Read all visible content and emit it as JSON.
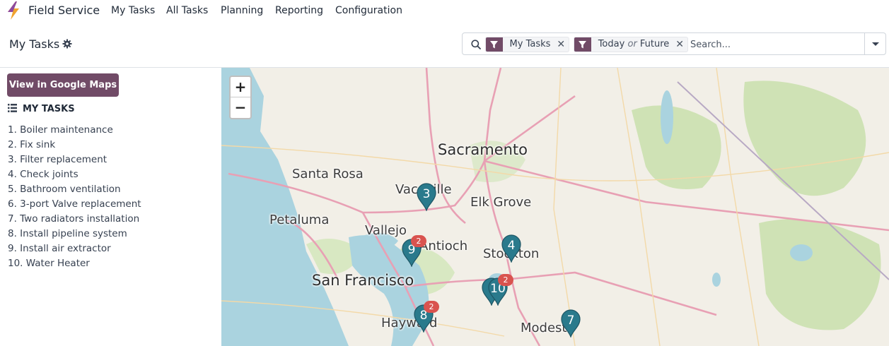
{
  "app": {
    "name": "Field Service",
    "logo_icon": "field-service-bolt-icon"
  },
  "menu": [
    "My Tasks",
    "All Tasks",
    "Planning",
    "Reporting",
    "Configuration"
  ],
  "breadcrumb": {
    "title": "My Tasks"
  },
  "search": {
    "placeholder": "Search...",
    "facets": [
      {
        "label": "My Tasks"
      },
      {
        "part1": "Today",
        "or": "or",
        "part2": "Future"
      }
    ]
  },
  "sidebar": {
    "gmaps_button": "View in Google Maps",
    "heading": "MY TASKS",
    "tasks": [
      "1. Boiler maintenance",
      "2. Fix sink",
      "3. Filter replacement",
      "4. Check joints",
      "5. Bathroom ventilation",
      "6. 3-port Valve replacement",
      "7. Two radiators installation",
      "8. Install pipeline system",
      "9. Install air extractor",
      "10. Water Heater"
    ]
  },
  "map": {
    "zoom_in": "+",
    "zoom_out": "−",
    "cities": [
      "Sacramento",
      "Santa Rosa",
      "Vacaville",
      "Elk Grove",
      "Petaluma",
      "Vallejo",
      "Antioch",
      "Stockton",
      "San Francisco",
      "Hayward",
      "Modesto"
    ],
    "markers": [
      {
        "label": "3",
        "badge": ""
      },
      {
        "label": "4",
        "badge": ""
      },
      {
        "label": "9",
        "badge": "2"
      },
      {
        "label": "10",
        "badge": "2"
      },
      {
        "label": "8",
        "badge": "2"
      },
      {
        "label": "7",
        "badge": ""
      }
    ]
  },
  "colors": {
    "brand": "#714b67",
    "marker": "#2a7a8c",
    "badge": "#d9534f"
  }
}
